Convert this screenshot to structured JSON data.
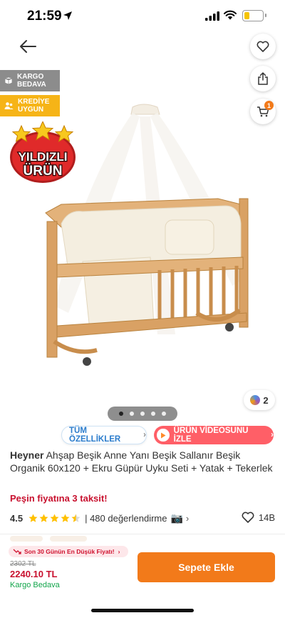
{
  "status_bar": {
    "time": "21:59",
    "battery_level": 0.25
  },
  "badges": {
    "cargo_line1": "KARGO",
    "cargo_line2": "BEDAVA",
    "credit_line1": "KREDİYE",
    "credit_line2": "UYGUN",
    "star_product_line1": "YILDIZLI",
    "star_product_line2": "ÜRÜN"
  },
  "cart": {
    "count": "1"
  },
  "gallery": {
    "media_count": "2",
    "dots": 5,
    "active_dot": 0
  },
  "pills": {
    "features": "TÜM ÖZELLİKLER",
    "video": "ÜRÜN VİDEOSUNU İZLE"
  },
  "product": {
    "brand": "Heyner",
    "name": " Ahşap Beşik Anne Yanı Beşik Sallanır Beşik Organik 60x120 + Ekru Güpür Uyku Seti + Yatak + Tekerlek",
    "installment": "Peşin fiyatına 3 taksit!",
    "rating": "4.5",
    "rating_stars": 4.5,
    "reviews": "| 480 değerlendirme",
    "favorites": "14B"
  },
  "bottom": {
    "lowest_price": "Son 30 Günün En Düşük Fiyatı!",
    "old_price": "2302 TL",
    "price": "2240.10 TL",
    "shipping": "Kargo Bedava",
    "add_to_cart": "Sepete Ekle"
  },
  "colors": {
    "accent": "#f27a1a",
    "price_red": "#c8102e",
    "green": "#11a54a",
    "video_pink": "#ff5f67"
  }
}
